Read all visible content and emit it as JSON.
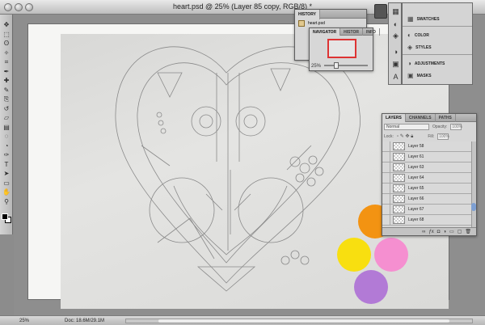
{
  "window": {
    "title": "heart.psd @ 25% (Layer 85 copy, RGB/8) *"
  },
  "toolbox": {
    "tools": [
      "move-icon",
      "marquee-icon",
      "lasso-icon",
      "magic-wand-icon",
      "crop-icon",
      "eyedropper-icon",
      "healing-icon",
      "brush-icon",
      "stamp-icon",
      "history-brush-icon",
      "eraser-icon",
      "gradient-icon",
      "blur-icon",
      "dodge-icon",
      "pen-icon",
      "type-icon",
      "path-select-icon",
      "shape-icon",
      "hand-icon",
      "zoom-icon"
    ]
  },
  "history_panel": {
    "tab": "HISTORY",
    "item": "heart.psd"
  },
  "navigator_panel": {
    "tabs": [
      "NAVIGATOR",
      "HISTOR",
      "INFO"
    ],
    "zoom": "25%"
  },
  "dock": {
    "items": [
      {
        "label": "SWATCHES",
        "icon": "swatches-icon"
      },
      {
        "label": "COLOR",
        "icon": "color-icon"
      },
      {
        "label": "STYLES",
        "icon": "styles-icon"
      },
      {
        "label": "ADJUSTMENTS",
        "icon": "adjustments-icon"
      },
      {
        "label": "MASKS",
        "icon": "masks-icon"
      }
    ]
  },
  "layers_panel": {
    "tabs": [
      "LAYERS",
      "CHANNELS",
      "PATHS"
    ],
    "blend_mode": "Normal",
    "opacity_label": "Opacity:",
    "opacity_value": "100%",
    "lock_label": "Lock:",
    "fill_label": "Fill:",
    "fill_value": "100%",
    "layers": [
      "Layer 58",
      "Layer 61",
      "Layer 63",
      "Layer 64",
      "Layer 65",
      "Layer 66",
      "Layer 67",
      "Layer 68"
    ]
  },
  "colors": {
    "orange": "#f39312",
    "yellow": "#f8df10",
    "pink": "#f58fd0",
    "purple": "#b27ad6"
  },
  "statusbar": {
    "zoom": "25%",
    "doc": "Doc: 18.6M/29.1M"
  }
}
